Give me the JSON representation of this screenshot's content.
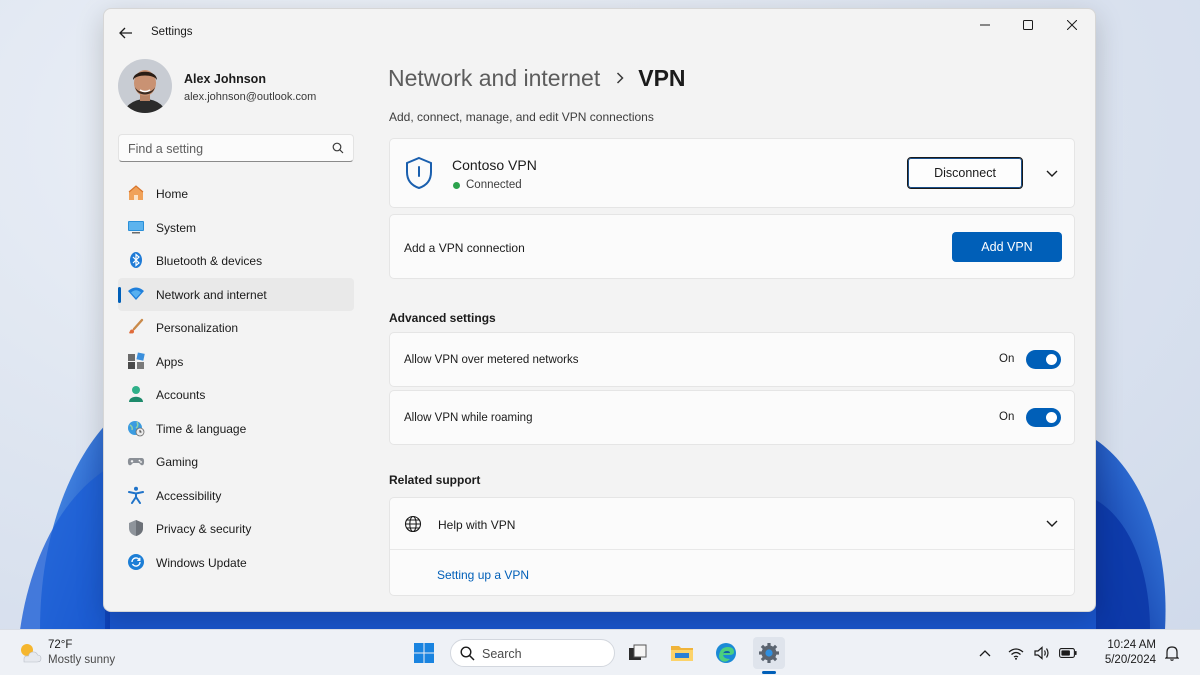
{
  "window": {
    "app_title": "Settings",
    "back_icon": "arrow-left-icon",
    "controls": [
      "minimize-icon",
      "maximize-icon",
      "close-icon"
    ]
  },
  "profile": {
    "name": "Alex Johnson",
    "email": "alex.johnson@outlook.com"
  },
  "search": {
    "placeholder": "Find a setting",
    "value": ""
  },
  "sidebar": {
    "items": [
      {
        "label": "Home",
        "icon": "home-icon",
        "selected": false
      },
      {
        "label": "System",
        "icon": "monitor-icon",
        "selected": false
      },
      {
        "label": "Bluetooth & devices",
        "icon": "bluetooth-icon",
        "selected": false
      },
      {
        "label": "Network and internet",
        "icon": "wifi-icon",
        "selected": true
      },
      {
        "label": "Personalization",
        "icon": "brush-icon",
        "selected": false
      },
      {
        "label": "Apps",
        "icon": "apps-icon",
        "selected": false
      },
      {
        "label": "Accounts",
        "icon": "person-icon",
        "selected": false
      },
      {
        "label": "Time & language",
        "icon": "globe-clock-icon",
        "selected": false
      },
      {
        "label": "Gaming",
        "icon": "gamepad-icon",
        "selected": false
      },
      {
        "label": "Accessibility",
        "icon": "accessibility-icon",
        "selected": false
      },
      {
        "label": "Privacy & security",
        "icon": "shield-icon",
        "selected": false
      },
      {
        "label": "Windows Update",
        "icon": "update-icon",
        "selected": false
      }
    ]
  },
  "header": {
    "parent": "Network and internet",
    "current": "VPN",
    "description": "Add, connect, manage, and edit VPN connections"
  },
  "vpn": {
    "name": "Contoso VPN",
    "status": "Connected",
    "status_color": "#2ba24c",
    "disconnect_label": "Disconnect"
  },
  "add_vpn": {
    "label": "Add a VPN connection",
    "button_label": "Add VPN"
  },
  "advanced": {
    "heading": "Advanced settings",
    "toggles": [
      {
        "label": "Allow VPN over metered networks",
        "state": "On",
        "on": true
      },
      {
        "label": "Allow VPN while roaming",
        "state": "On",
        "on": true
      }
    ]
  },
  "support": {
    "heading": "Related support",
    "item_label": "Help with VPN",
    "link": "Setting up a VPN"
  },
  "taskbar": {
    "weather_temp": "72°F",
    "weather_desc": "Mostly sunny",
    "search_label": "Search",
    "time": "10:24 AM",
    "date": "5/20/2024"
  },
  "colors": {
    "accent": "#005fb8",
    "window_bg": "#f3f3f3",
    "card_bg": "#fbfbfb"
  }
}
